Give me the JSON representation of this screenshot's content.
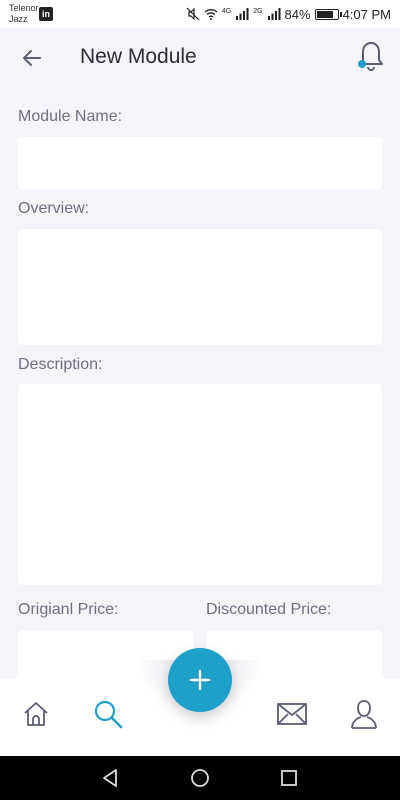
{
  "status_bar": {
    "carrier_line1": "Telenor",
    "carrier_line2": "Jazz",
    "network1": "4G",
    "network2": "2G",
    "battery": "84%",
    "battery_level": 0.84,
    "time": "4:07 PM"
  },
  "header": {
    "title": "New Module"
  },
  "form": {
    "module_name_label": "Module Name:",
    "module_name_value": "",
    "overview_label": "Overview:",
    "overview_value": "",
    "description_label": "Description:",
    "description_value": "",
    "original_price_label": "Origianl Price:",
    "original_price_value": "",
    "discounted_price_label": "Discounted Price:",
    "discounted_price_value": ""
  },
  "bottom_nav": {
    "items": [
      {
        "icon": "home-icon",
        "active": false
      },
      {
        "icon": "search-icon",
        "active": true
      },
      {
        "icon": "mail-icon",
        "active": false
      },
      {
        "icon": "profile-icon",
        "active": false
      }
    ],
    "fab_icon": "plus-icon"
  },
  "colors": {
    "accent": "#1fa0c8",
    "background": "#f4f4fa",
    "label": "#6e6e86",
    "icon": "#5b5d74"
  }
}
